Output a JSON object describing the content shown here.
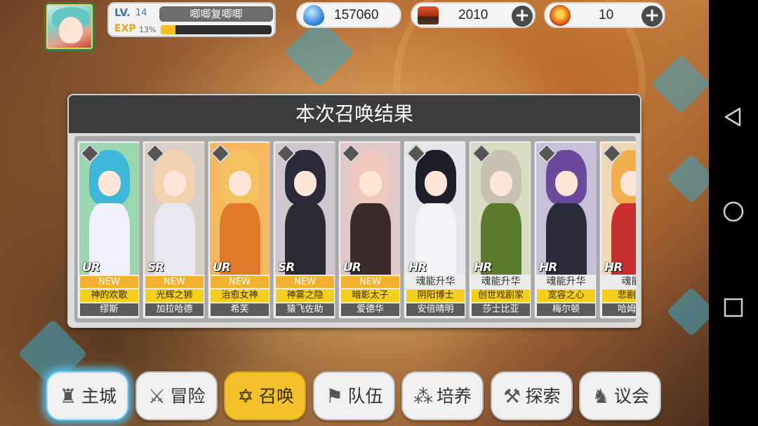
{
  "player": {
    "level_label": "LV.",
    "level": "14",
    "name": "唧唧复唧唧",
    "exp_label": "EXP",
    "exp_percent_text": "13%",
    "exp_progress": 0.13
  },
  "resources": [
    {
      "name": "soul-crystal",
      "icon": "blue-gem-icon",
      "value": "157060",
      "has_add": false
    },
    {
      "name": "summon-chest",
      "icon": "treasure-chest-icon",
      "value": "2010",
      "has_add": true
    },
    {
      "name": "summon-orb",
      "icon": "fire-orb-icon",
      "value": "10",
      "has_add": true
    }
  ],
  "summon_panel": {
    "title": "本次召唤结果",
    "cards": [
      {
        "rarity": "UR",
        "tag": "NEW",
        "tag_style": "new",
        "title": "神的欢歌",
        "name": "缪斯",
        "colors": {
          "hair": "#3fb7d8",
          "body": "#f0f0ff",
          "bg": "#9ad6b0"
        }
      },
      {
        "rarity": "SR",
        "tag": "NEW",
        "tag_style": "new",
        "title": "光辉之狮",
        "name": "加拉哈德",
        "colors": {
          "hair": "#f2d2b0",
          "body": "#e8e8f0",
          "bg": "#d8d0c8"
        }
      },
      {
        "rarity": "UR",
        "tag": "NEW",
        "tag_style": "new",
        "title": "治愈女神",
        "name": "希芙",
        "colors": {
          "hair": "#f5c060",
          "body": "#e07a2a",
          "bg": "#f4b860"
        }
      },
      {
        "rarity": "SR",
        "tag": "NEW",
        "tag_style": "new",
        "title": "神雾之隐",
        "name": "猿飞佐助",
        "colors": {
          "hair": "#2a2a3a",
          "body": "#2b2b33",
          "bg": "#cfc6cf"
        }
      },
      {
        "rarity": "UR",
        "tag": "NEW",
        "tag_style": "new",
        "title": "暗影太子",
        "name": "爱德华",
        "colors": {
          "hair": "#f0c8c0",
          "body": "#3a2a2a",
          "bg": "#e0c8c8"
        }
      },
      {
        "rarity": "HR",
        "tag": "魂能升华",
        "tag_style": "grey",
        "title": "阴阳博士",
        "name": "安倍晴明",
        "colors": {
          "hair": "#1e1e28",
          "body": "#f4f4f8",
          "bg": "#e8e4ec"
        }
      },
      {
        "rarity": "HR",
        "tag": "魂能升华",
        "tag_style": "grey",
        "title": "创世戏剧家",
        "name": "莎士比亚",
        "colors": {
          "hair": "#c8c0b0",
          "body": "#5a7a2e",
          "bg": "#d8dcc0"
        }
      },
      {
        "rarity": "HR",
        "tag": "魂能升华",
        "tag_style": "grey",
        "title": "宽容之心",
        "name": "梅尔顿",
        "colors": {
          "hair": "#6a4a9a",
          "body": "#2a2a3a",
          "bg": "#c8c0d8"
        }
      },
      {
        "rarity": "HR",
        "tag": "魂能",
        "tag_style": "grey",
        "title": "悲剧复",
        "name": "哈姆雷",
        "colors": {
          "hair": "#f2b050",
          "body": "#c83030",
          "bg": "#eed8b8"
        }
      }
    ]
  },
  "nav": [
    {
      "key": "home",
      "label": "主城",
      "icon": "castle-icon",
      "glyph": "♜",
      "state": "home"
    },
    {
      "key": "adventure",
      "label": "冒险",
      "icon": "crossed-swords-icon",
      "glyph": "⚔",
      "state": ""
    },
    {
      "key": "summon",
      "label": "召唤",
      "icon": "hexagram-icon",
      "glyph": "✡",
      "state": "active"
    },
    {
      "key": "team",
      "label": "队伍",
      "icon": "team-flag-icon",
      "glyph": "⚑",
      "state": ""
    },
    {
      "key": "train",
      "label": "培养",
      "icon": "triple-circle-icon",
      "glyph": "⁂",
      "state": ""
    },
    {
      "key": "explore",
      "label": "探索",
      "icon": "pickaxe-icon",
      "glyph": "⚒",
      "state": ""
    },
    {
      "key": "council",
      "label": "议会",
      "icon": "dragon-icon",
      "glyph": "♞",
      "state": ""
    }
  ],
  "system_nav": [
    "back-icon",
    "home-circle-icon",
    "recent-apps-icon"
  ]
}
